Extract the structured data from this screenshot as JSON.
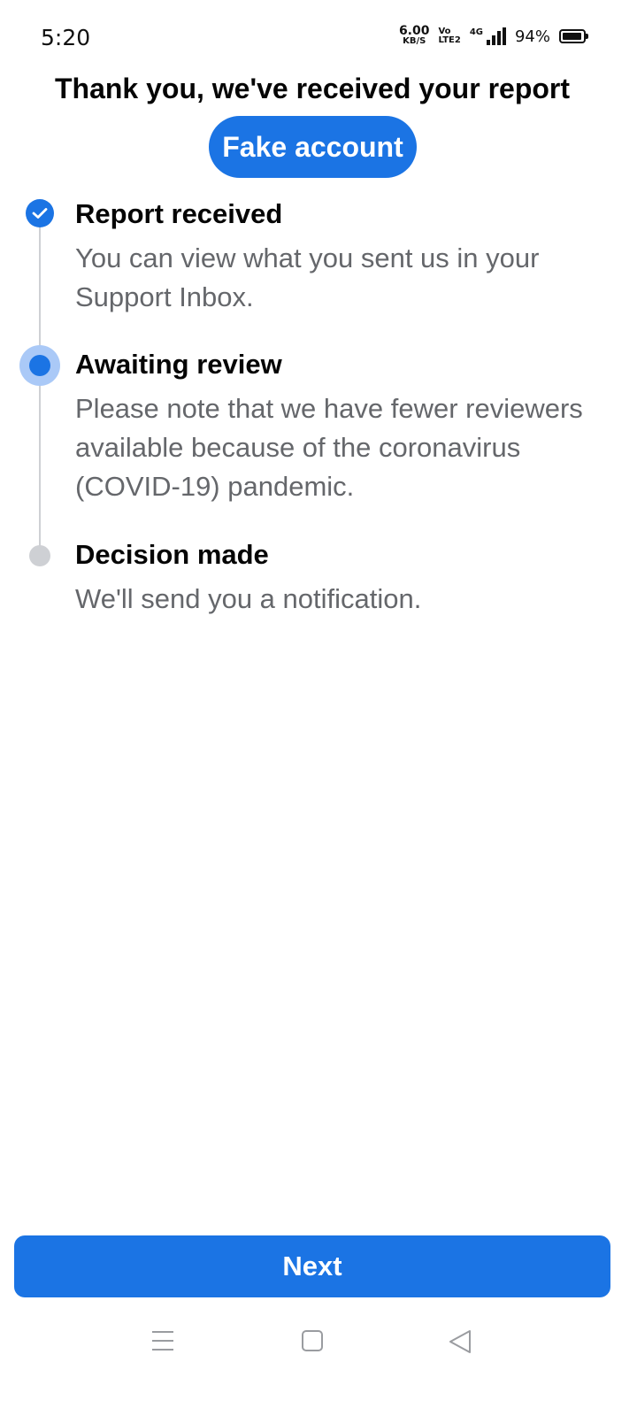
{
  "status_bar": {
    "time": "5:20",
    "net_speed_value": "6.00",
    "net_speed_unit": "KB/S",
    "volte_top": "Vo",
    "volte_bottom": "LTE2",
    "network_type": "4G",
    "battery_percent": "94%",
    "battery_level": 0.94
  },
  "header": {
    "title": "Thank you, we've received your report",
    "report_type": "Fake account"
  },
  "steps": [
    {
      "status": "done",
      "title": "Report received",
      "description": "You can view what you sent us in your Support Inbox."
    },
    {
      "status": "current",
      "title": "Awaiting review",
      "description": "Please note that we have fewer reviewers available because of the coronavirus (COVID-19) pandemic."
    },
    {
      "status": "pending",
      "title": "Decision made",
      "description": "We'll send you a notification."
    }
  ],
  "footer": {
    "next_label": "Next"
  },
  "colors": {
    "accent": "#1b74e4",
    "accent_light": "#aac9f7",
    "pending": "#ced0d4",
    "secondary_text": "#65676b"
  },
  "nav_bar": {
    "icons": [
      "menu-icon",
      "home-square-icon",
      "back-triangle-icon"
    ]
  }
}
